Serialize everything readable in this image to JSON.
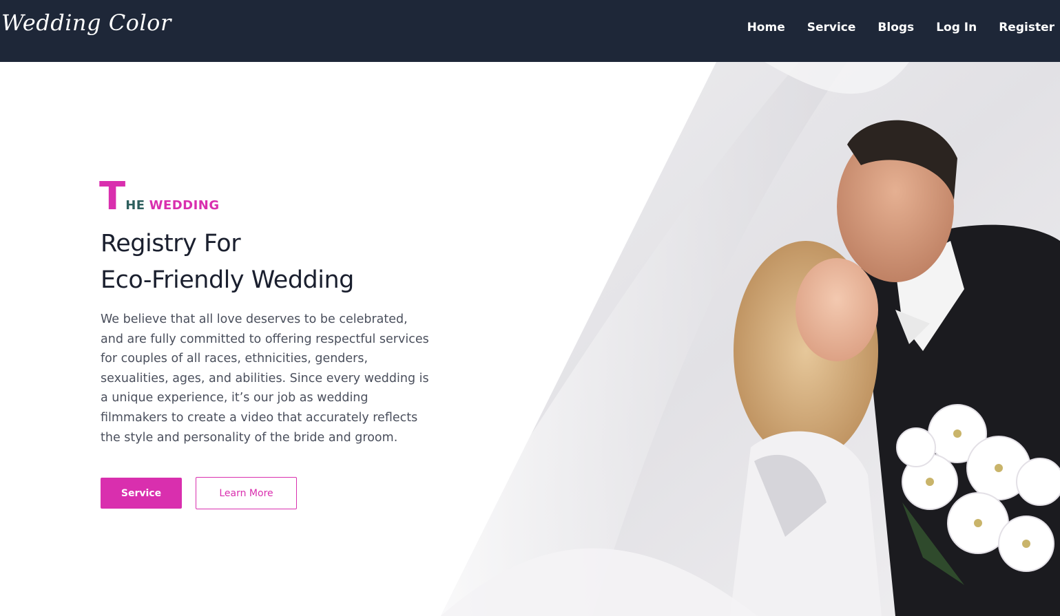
{
  "brand": {
    "logo_text": "Wedding Color"
  },
  "nav": {
    "items": [
      {
        "label": "Home"
      },
      {
        "label": "Service"
      },
      {
        "label": "Blogs"
      },
      {
        "label": "Log In"
      },
      {
        "label": "Register"
      }
    ]
  },
  "hero": {
    "eyebrow_initial": "T",
    "eyebrow_part1": "HE",
    "eyebrow_part2": "WEDDING",
    "headline_line1": "Registry For",
    "headline_line2": "Eco-Friendly Wedding",
    "paragraph": "We believe that all love deserves to be celebrated, and are fully committed to offering respectful services for couples of all races, ethnicities, genders, sexualities, ages, and abilities. Since every wedding is a unique experience, it’s our job as wedding filmmakers to create a video that accurately reflects the style and personality of the bride and groom.",
    "primary_button_label": "Service",
    "secondary_button_label": "Learn More",
    "image_alt": "Bride and groom embracing under a white veil"
  },
  "colors": {
    "navbar_bg": "#1e2738",
    "accent": "#d92fae",
    "eyebrow_secondary": "#2d5f5d",
    "heading": "#1a1f2e",
    "body_text": "#4a4f5c"
  }
}
